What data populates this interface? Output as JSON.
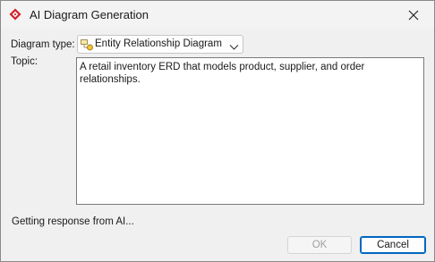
{
  "window": {
    "title": "AI Diagram Generation",
    "app_icon": "visual-paradigm-logo-icon",
    "close_icon": "close-icon"
  },
  "form": {
    "diagram_type_label": "Diagram type:",
    "diagram_type_value": "Entity Relationship Diagram",
    "diagram_type_icon": "erd-icon",
    "topic_label": "Topic:",
    "topic_value": "A retail inventory ERD that models product, supplier, and order relationships."
  },
  "status": {
    "text": "Getting response from AI..."
  },
  "buttons": {
    "ok_label": "OK",
    "ok_enabled": false,
    "cancel_label": "Cancel"
  },
  "colors": {
    "accent": "#0067c0",
    "logo_red": "#d0232b",
    "window_bg": "#f0f0f0"
  }
}
